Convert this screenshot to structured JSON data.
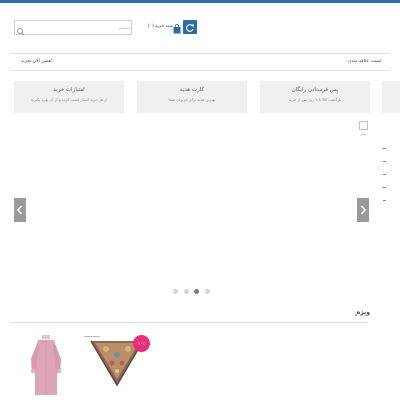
{
  "header": {
    "search_placeholder": "جستجو",
    "cart_label": "سبد خرید (۰)",
    "accent_color": "#2b6ea8"
  },
  "nav": {
    "left_link": "همین الان بخرید!",
    "right_link": "لیست علاقه مندی"
  },
  "features": [
    {
      "title": "امتیازات خرید",
      "desc": "از هر خرید امتیاز کسب کرده و از آن بهره بگیرید"
    },
    {
      "title": "کارت هدیه",
      "desc": "بهترین هدیه برای عزیزان شما"
    },
    {
      "title": "پس فرستادن رایگان",
      "desc": "بازگشت کالا تا ۷ روز پس از خرید"
    }
  ],
  "slider": {
    "slide_count": 4,
    "active_slide": 3
  },
  "special": {
    "title": "ویژه",
    "products": [
      {
        "name": "pink-coat-product",
        "discount_badge": ""
      },
      {
        "name": "scarf-product",
        "discount_badge": "۲۰٪"
      }
    ],
    "badge_color": "#e8307a"
  },
  "icons": [
    "search-icon",
    "shopping-bag-icon",
    "refresh-icon",
    "chevron-left-icon",
    "chevron-right-icon",
    "image-icon"
  ]
}
